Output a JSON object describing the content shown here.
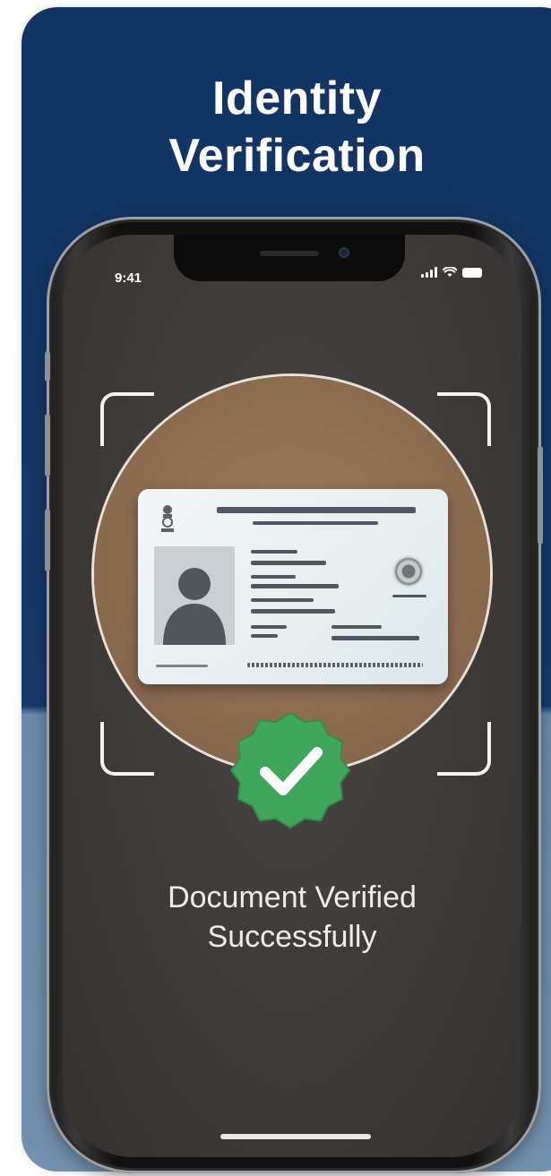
{
  "header": {
    "title_line1": "Identity",
    "title_line2": "Verification"
  },
  "status_bar": {
    "time": "9:41",
    "icons": [
      "cellular-signal-icon",
      "wifi-icon",
      "battery-icon"
    ]
  },
  "scanner": {
    "document": "id-card",
    "status_icon": "checkmark-badge-icon"
  },
  "result": {
    "line1": "Document Verified",
    "line2": "Successfully"
  },
  "colors": {
    "header_background": "#123462",
    "lower_background": "#7391ad",
    "success_green": "#3fa65b",
    "screen_background": "#3d3a38"
  }
}
